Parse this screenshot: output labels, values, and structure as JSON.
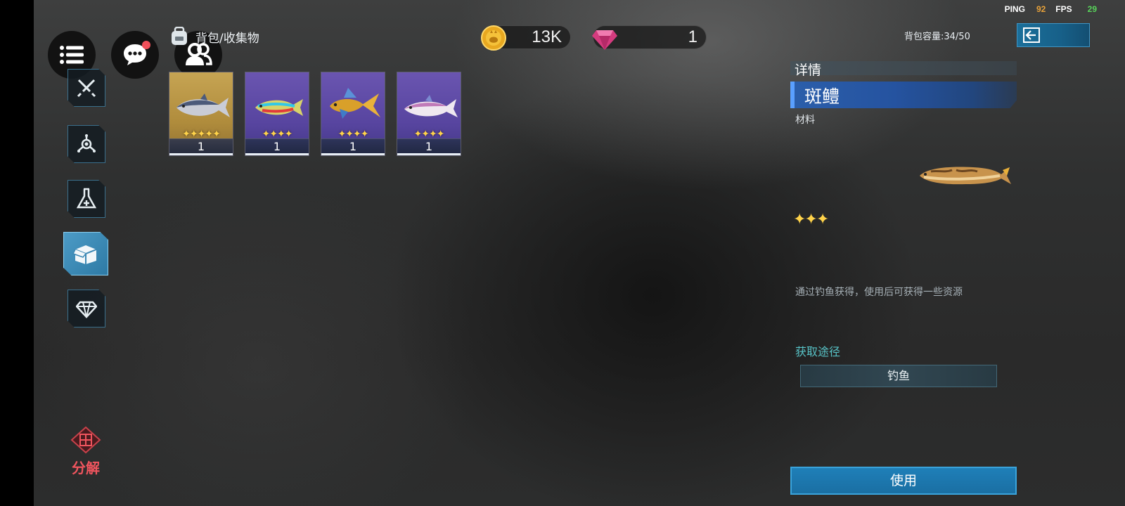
{
  "status": {
    "ping_label": "PING",
    "ping_value": "92",
    "fps_label": "FPS",
    "fps_value": "29"
  },
  "breadcrumb": {
    "text": "背包/收集物"
  },
  "currency": {
    "coins": "13K",
    "gems": "1"
  },
  "bag": {
    "capacity": "背包容量:34/50"
  },
  "nav": [
    {
      "icon": "swords-icon"
    },
    {
      "icon": "network-icon"
    },
    {
      "icon": "flask-icon"
    },
    {
      "icon": "box-icon",
      "active": true
    },
    {
      "icon": "diamond-icon"
    }
  ],
  "decompose": {
    "label": "分解"
  },
  "items": [
    {
      "name": "tuna",
      "stars": "✦✦✦✦✦",
      "count": "1",
      "rarity": "gold"
    },
    {
      "name": "neon-fish",
      "stars": "✦✦✦✦",
      "count": "1",
      "rarity": "purple"
    },
    {
      "name": "goldfish",
      "stars": "✦✦✦✦",
      "count": "1",
      "rarity": "purple"
    },
    {
      "name": "pink-fish",
      "stars": "✦✦✦✦",
      "count": "1",
      "rarity": "purple"
    }
  ],
  "detail": {
    "header": "详情",
    "name": "斑鳢",
    "type": "材料",
    "stars": "✦✦✦",
    "description": "通过钓鱼获得，使用后可获得一些资源",
    "obtain_title": "获取途径",
    "obtain_method": "钓鱼",
    "use_label": "使用"
  },
  "colors": {
    "accent": "#1f7fb8",
    "gold": "#ffd34a",
    "danger": "#f0555e",
    "teal": "#58c4c8"
  }
}
